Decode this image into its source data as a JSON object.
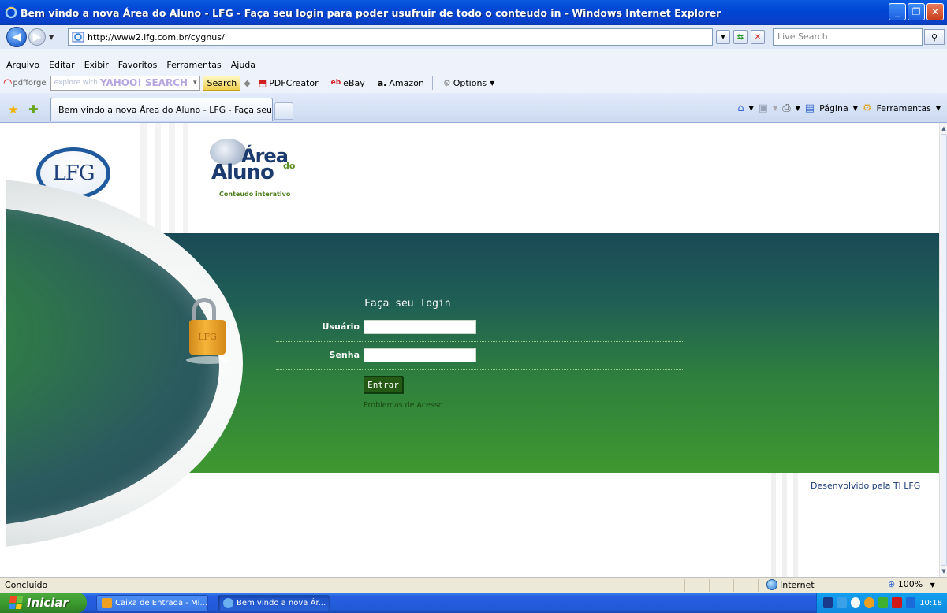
{
  "window": {
    "title": "Bem vindo a nova Área do Aluno - LFG - Faça seu login para poder usufruir de todo o conteudo in - Windows Internet Explorer",
    "minimize": "_",
    "maximize": "❐",
    "close": "✕"
  },
  "address_bar": {
    "url": "http://www2.lfg.com.br/cygnus/",
    "search_placeholder": "Live Search"
  },
  "menu": {
    "items": [
      "Arquivo",
      "Editar",
      "Exibir",
      "Favoritos",
      "Ferramentas",
      "Ajuda"
    ]
  },
  "toolbar": {
    "pdfforge_label": "pdfforge",
    "search_hint": "explore with",
    "search_brand": "YAHOO! SEARCH",
    "search_button": "Search",
    "pdfcreator_label": "PDFCreator",
    "ebay_label": "eBay",
    "amazon_label": "Amazon",
    "options_label": "Options"
  },
  "tabs": {
    "active_tab": "Bem vindo a nova Área do Aluno - LFG - Faça seu logi...",
    "page_menu": "Página",
    "tools_menu": "Ferramentas"
  },
  "page": {
    "logo_text": "LFG",
    "area_logo": {
      "area": "Área",
      "do": "do",
      "aluno": "Aluno",
      "subtitle": "Conteudo interativo"
    },
    "padlock_text": "LFG",
    "login": {
      "title": "Faça seu login",
      "user_label": "Usuário",
      "user_value": "",
      "password_label": "Senha",
      "password_value": "",
      "submit_label": "Entrar",
      "problems_link": "Problemas de Acesso"
    },
    "footer_text": "Desenvolvido pela TI  LFG"
  },
  "status_bar": {
    "status": "Concluído",
    "zone": "Internet",
    "zoom": "100%"
  },
  "taskbar": {
    "start_label": "Iniciar",
    "tasks": [
      {
        "label": "Caixa de Entrada - Mi..."
      },
      {
        "label": "Bem vindo a nova Ár..."
      }
    ],
    "clock": "10:18"
  },
  "colors": {
    "title_bar": "#0a5ae0",
    "panel_green": "#2e7f3e",
    "submit_green": "#245a16",
    "start_green": "#3c9a2e"
  }
}
